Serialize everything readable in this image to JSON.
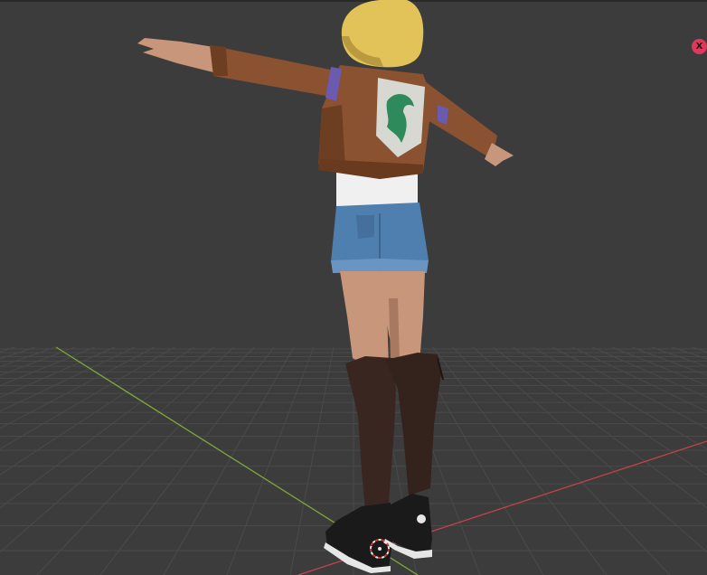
{
  "viewport": {
    "background_color": "#3c3c3c",
    "grid_color": "#4a4a4a",
    "x_axis_color": "#c2424e",
    "y_axis_color": "#7fa83a"
  },
  "gizmo": {
    "x_label": "X",
    "x_color": "#e0385a"
  },
  "cursor_3d": {
    "icon": "3d-cursor-icon",
    "ring_color": "#e8e8e8",
    "accent_color": "#d0392e"
  },
  "model": {
    "hair_color": "#e2c35a",
    "jacket_color": "#8a5230",
    "shirt_color": "#f0f0f0",
    "shorts_color": "#4f7fae",
    "skin_color": "#c8967a",
    "boot_color": "#3a2620",
    "sneaker_color": "#1a1a1a",
    "emblem_color": "#2e8a5a"
  }
}
